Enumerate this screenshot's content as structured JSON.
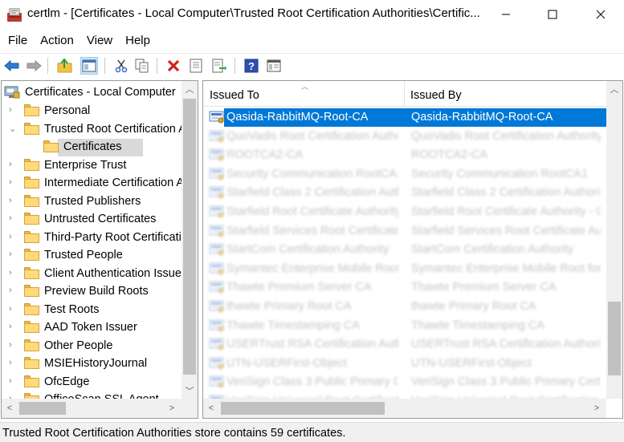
{
  "window": {
    "title": "certlm - [Certificates - Local Computer\\Trusted Root Certification Authorities\\Certific...",
    "controls": {
      "minimize": "minimize",
      "maximize": "maximize",
      "close": "close"
    }
  },
  "menu": [
    "File",
    "Action",
    "View",
    "Help"
  ],
  "toolbar": {
    "buttons": [
      "back-arrow-icon",
      "forward-arrow-icon",
      "up-folder-icon",
      "show-hide-tree-icon",
      "cut-icon",
      "copy-icon",
      "delete-icon",
      "properties-icon",
      "export-icon",
      "help-icon",
      "view-icon"
    ]
  },
  "tree": {
    "root": "Certificates - Local Computer",
    "items": [
      {
        "label": "Personal",
        "expanded": false
      },
      {
        "label": "Trusted Root Certification Authorities",
        "expanded": true
      },
      {
        "label": "Certificates",
        "child": true,
        "selected": true
      },
      {
        "label": "Enterprise Trust",
        "expanded": false
      },
      {
        "label": "Intermediate Certification Authorities",
        "expanded": false
      },
      {
        "label": "Trusted Publishers",
        "expanded": false
      },
      {
        "label": "Untrusted Certificates",
        "expanded": false
      },
      {
        "label": "Third-Party Root Certification Authorities",
        "expanded": false
      },
      {
        "label": "Trusted People",
        "expanded": false
      },
      {
        "label": "Client Authentication Issuers",
        "expanded": false
      },
      {
        "label": "Preview Build Roots",
        "expanded": false
      },
      {
        "label": "Test Roots",
        "expanded": false
      },
      {
        "label": "AAD Token Issuer",
        "expanded": false
      },
      {
        "label": "Other People",
        "expanded": false
      },
      {
        "label": "MSIEHistoryJournal",
        "expanded": false
      },
      {
        "label": "OfcEdge",
        "expanded": false
      },
      {
        "label": "OfficeScan SSL Agent",
        "expanded": false
      }
    ]
  },
  "list": {
    "columns": [
      "Issued To",
      "Issued By"
    ],
    "rows": [
      {
        "issued_to": "Qasida-RabbitMQ-Root-CA",
        "issued_by": "Qasida-RabbitMQ-Root-CA",
        "selected": true,
        "blurred": false
      },
      {
        "issued_to": "QuoVadis Root Certification Authority",
        "issued_by": "QuoVadis Root Certification Authority",
        "blurred": true
      },
      {
        "issued_to": "ROOTCA2-CA",
        "issued_by": "ROOTCA2-CA",
        "blurred": true
      },
      {
        "issued_to": "Security Communication RootCA1",
        "issued_by": "Security Communication RootCA1",
        "blurred": true
      },
      {
        "issued_to": "Starfield Class 2 Certification Authority",
        "issued_by": "Starfield Class 2 Certification Authority",
        "blurred": true
      },
      {
        "issued_to": "Starfield Root Certificate Authority - G2",
        "issued_by": "Starfield Root Certificate Authority - G2",
        "blurred": true
      },
      {
        "issued_to": "Starfield Services Root Certificate Authority",
        "issued_by": "Starfield Services Root Certificate Authority",
        "blurred": true
      },
      {
        "issued_to": "StartCom Certification Authority",
        "issued_by": "StartCom Certification Authority",
        "blurred": true
      },
      {
        "issued_to": "Symantec Enterprise Mobile Root for Microsoft",
        "issued_by": "Symantec Enterprise Mobile Root for Microsoft",
        "blurred": true
      },
      {
        "issued_to": "Thawte Premium Server CA",
        "issued_by": "Thawte Premium Server CA",
        "blurred": true
      },
      {
        "issued_to": "thawte Primary Root CA",
        "issued_by": "thawte Primary Root CA",
        "blurred": true
      },
      {
        "issued_to": "Thawte Timestamping CA",
        "issued_by": "Thawte Timestamping CA",
        "blurred": true
      },
      {
        "issued_to": "USERTrust RSA Certification Authority",
        "issued_by": "USERTrust RSA Certification Authority",
        "blurred": true
      },
      {
        "issued_to": "UTN-USERFirst-Object",
        "issued_by": "UTN-USERFirst-Object",
        "blurred": true
      },
      {
        "issued_to": "VeriSign Class 3 Public Primary Certification Authority",
        "issued_by": "VeriSign Class 3 Public Primary Certification Authority",
        "blurred": true
      },
      {
        "issued_to": "VeriSign Universal Root Certification Authority",
        "issued_by": "VeriSign Universal Root Certification Authority",
        "blurred": true
      }
    ]
  },
  "status": "Trusted Root Certification Authorities store contains 59 certificates.",
  "colors": {
    "selection": "#0078d7",
    "folder": "#ffd97a",
    "tree_selected": "#d9d9d9"
  }
}
